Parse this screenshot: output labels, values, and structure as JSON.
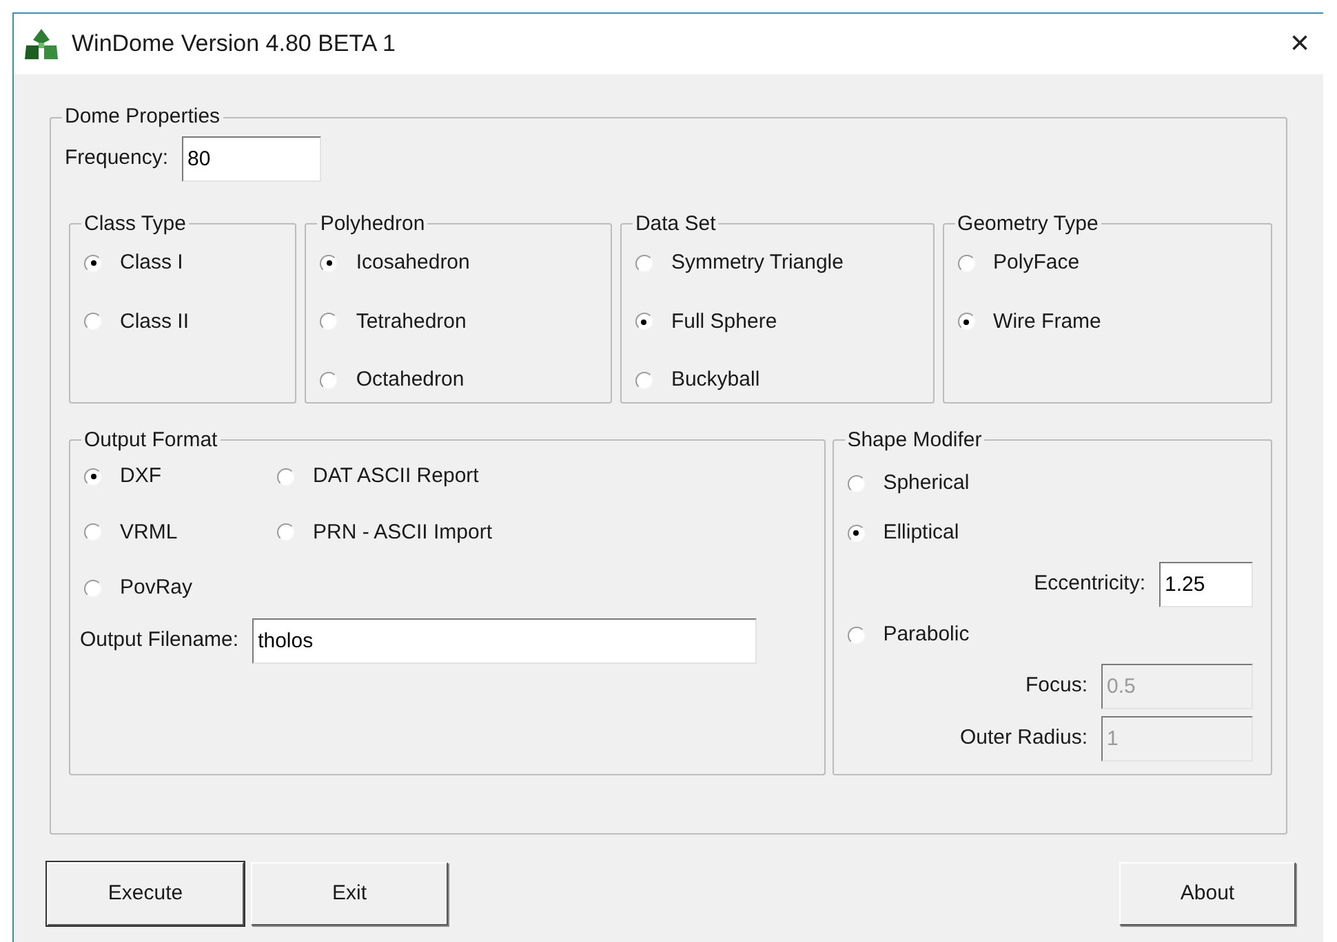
{
  "window": {
    "title": "WinDome Version 4.80 BETA 1",
    "close": "×"
  },
  "dome_properties": {
    "title": "Dome Properties",
    "frequency": {
      "label": "Frequency:",
      "value": "80"
    },
    "groups": [
      {
        "title": "Class Type",
        "options": [
          {
            "label": "Class I",
            "selected": true
          },
          {
            "label": "Class II",
            "selected": false
          }
        ]
      },
      {
        "title": "Polyhedron",
        "options": [
          {
            "label": "Icosahedron",
            "selected": true
          },
          {
            "label": "Tetrahedron",
            "selected": false
          },
          {
            "label": "Octahedron",
            "selected": false
          }
        ]
      },
      {
        "title": "Data Set",
        "options": [
          {
            "label": "Symmetry Triangle",
            "selected": false
          },
          {
            "label": "Full Sphere",
            "selected": true
          },
          {
            "label": "Buckyball",
            "selected": false
          }
        ]
      },
      {
        "title": "Geometry Type",
        "options": [
          {
            "label": "PolyFace",
            "selected": false
          },
          {
            "label": "Wire Frame",
            "selected": true
          }
        ]
      }
    ],
    "output_format": {
      "title": "Output Format",
      "options": [
        {
          "label": "DXF",
          "selected": true
        },
        {
          "label": "DAT ASCII Report",
          "selected": false
        },
        {
          "label": "VRML",
          "selected": false
        },
        {
          "label": "PRN - ASCII Import",
          "selected": false
        },
        {
          "label": "PovRay",
          "selected": false
        }
      ],
      "filename": {
        "label": "Output Filename:",
        "value": "tholos"
      }
    },
    "shape_modifier": {
      "title": "Shape Modifer",
      "items": [
        {
          "kind": "radio",
          "label": "Spherical",
          "selected": false
        },
        {
          "kind": "radio",
          "label": "Elliptical",
          "selected": true
        },
        {
          "kind": "field",
          "label": "Eccentricity:",
          "value": "1.25",
          "disabled": false
        },
        {
          "kind": "radio",
          "label": "Parabolic",
          "selected": false
        },
        {
          "kind": "field",
          "label": "Focus:",
          "value": "0.5",
          "disabled": true
        },
        {
          "kind": "field",
          "label": "Outer Radius:",
          "value": "1",
          "disabled": true
        }
      ]
    }
  },
  "buttons": {
    "left": [
      "Execute",
      "Exit"
    ],
    "right": [
      "About"
    ]
  }
}
